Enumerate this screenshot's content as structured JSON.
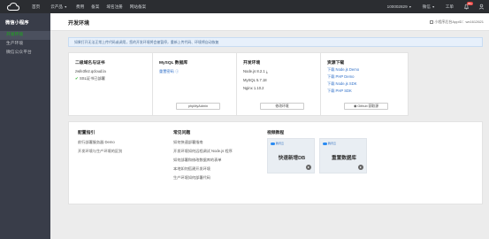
{
  "topbar": {
    "logo_icon": "cloud-logo-icon",
    "nav": [
      "首页",
      "云产品",
      "费用",
      "备案",
      "域名注册",
      "网站备案"
    ],
    "account": "100002829",
    "menu_label": "微信",
    "ticket": "工单",
    "badge": "99+",
    "icons": [
      "bell-icon",
      "user-icon"
    ]
  },
  "sidebar": {
    "title": "微信小程序",
    "items": [
      "开发环境",
      "生产环境",
      "微信公众平台"
    ],
    "active_index": 0
  },
  "header": {
    "page_title": "开发环境",
    "appid_text": "小程序后台AppID：wx1612621"
  },
  "notice": "如果打开无法正常上传代码或调用，您的开发环境将会被暂停，重新上传代码、环境将自动恢复",
  "cards": {
    "domain": {
      "title": "二级域名与证书",
      "domain": "zwfe3fe2.qcloud.la",
      "ssl": "SSL证书已部署"
    },
    "mysql": {
      "title": "MySQL 数据库",
      "password_link": "重置密码",
      "button": "phpMyAdmin"
    },
    "env": {
      "title": "开发环境",
      "node": "Node.js 8.2.1",
      "mysql": "MySQL 5.7.18",
      "nginx": "Nginx 1.10.2",
      "button": "修改环境"
    },
    "resources": {
      "title": "资源下载",
      "links": [
        "下载 Node.js Demo",
        "下载 PHP Demo",
        "下载 Node.js SDK",
        "下载 PHP SDK"
      ],
      "button": "Github 获取源"
    }
  },
  "guides": {
    "title": "配置指引",
    "items": [
      "前行部署服务器 Demo",
      "开发环境与生产环境的区别"
    ]
  },
  "faq": {
    "title": "常见问题",
    "items": [
      "如何快速部署指南",
      "开发环境如何远程调试 Node.js 程序",
      "如何部署和修改数据库的表单",
      "本地如何搭建开发环境",
      "生产环境如何部署代码"
    ]
  },
  "videos": {
    "title": "视频教程",
    "brand": "腾讯云",
    "items": [
      "快速新增DB",
      "重置数据库"
    ]
  }
}
